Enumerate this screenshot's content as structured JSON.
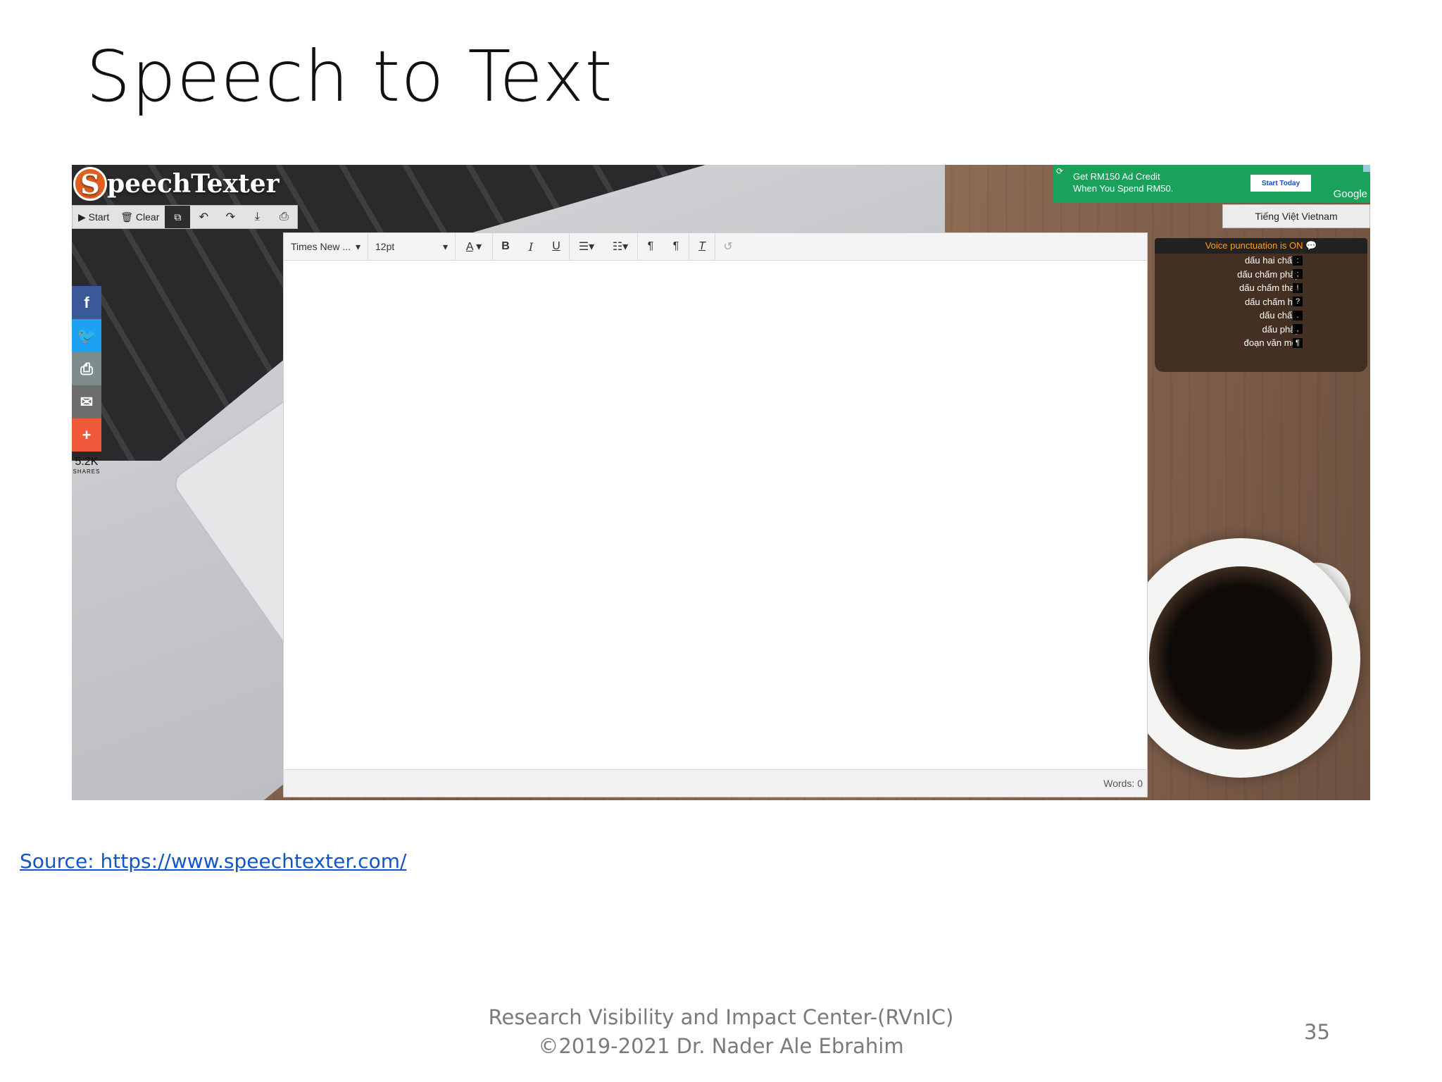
{
  "slide": {
    "title": "Speech to Text",
    "source_link": "Source: https://www.speechtexter.com/",
    "footer_line1": "Research Visibility and Impact Center-(RVnIC)",
    "footer_line2": "©2019-2021 Dr. Nader Ale Ebrahim",
    "page_number": "35"
  },
  "app": {
    "logo_letter": "S",
    "logo_text": "peechTexter",
    "toolbar": {
      "start_label": "▶ Start",
      "clear_label": "🗑 Clear",
      "icons": [
        "copy-icon",
        "undo-icon",
        "redo-icon",
        "download-icon",
        "print-icon"
      ],
      "glyphs": [
        "⧉",
        "↶",
        "↷",
        "⤓",
        "⎙"
      ]
    },
    "ad": {
      "line1": "Get RM150 Ad Credit",
      "line2": "When You Spend RM50.",
      "button": "Start Today",
      "brand": "Google"
    },
    "language_button": "Tiếng Việt Vietnam",
    "share": {
      "count": "5.2K",
      "label": "SHARES",
      "colors": {
        "facebook": "#3b5998",
        "twitter": "#1da1f2",
        "print": "#7f8c8d",
        "email": "#6d6d6d",
        "more": "#f05a3a"
      }
    },
    "editor": {
      "font_select": "Times New ...",
      "size_select": "12pt",
      "words_label": "Words: 0",
      "content": ""
    },
    "punctuation": {
      "header": "Voice punctuation is ON 💬",
      "items": [
        {
          "label": "dấu hai chấm",
          "symbol": ":"
        },
        {
          "label": "dấu chấm phẩy",
          "symbol": ";"
        },
        {
          "label": "dấu chấm than",
          "symbol": "!"
        },
        {
          "label": "dấu chấm hỏi",
          "symbol": "?"
        },
        {
          "label": "dấu chấm",
          "symbol": "."
        },
        {
          "label": "dấu phẩy",
          "symbol": ","
        },
        {
          "label": "đoạn văn mới",
          "symbol": "¶"
        }
      ]
    }
  }
}
